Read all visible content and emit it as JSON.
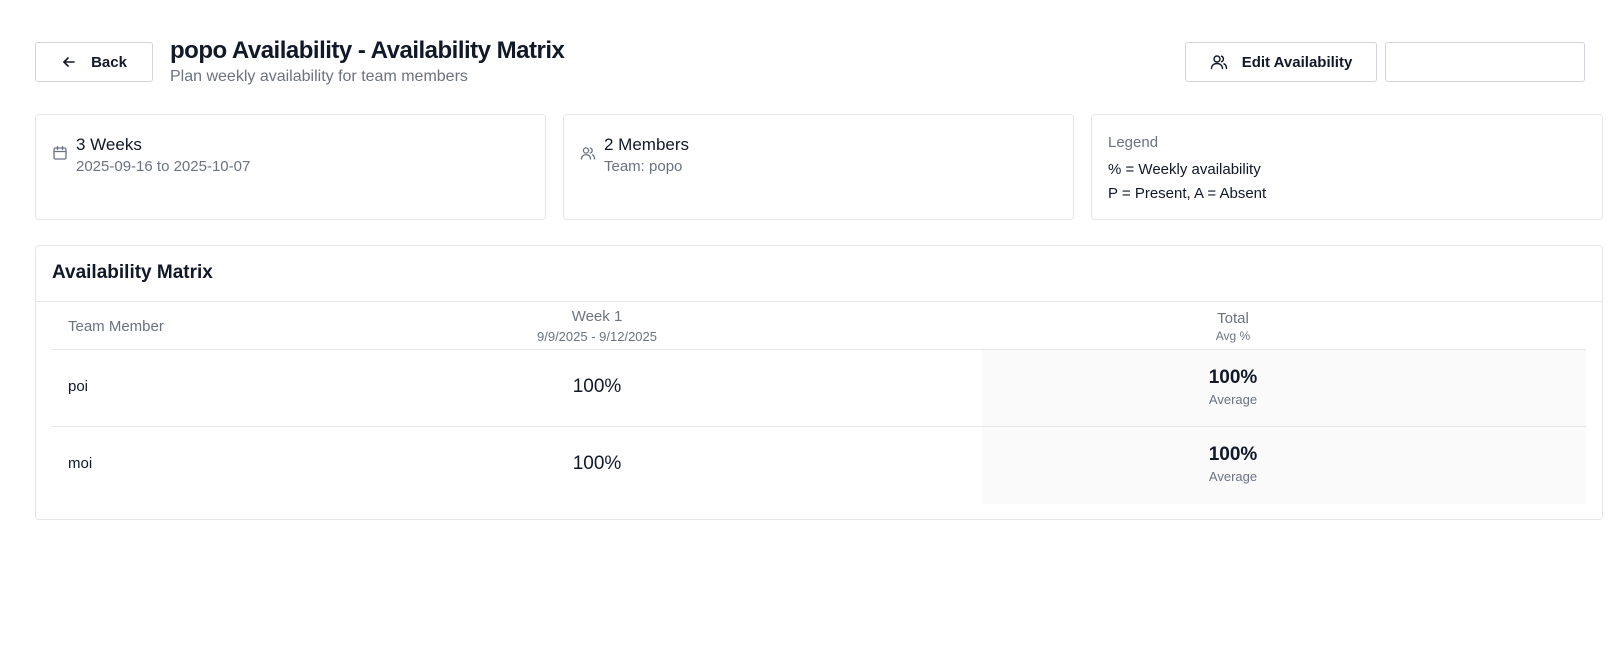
{
  "header": {
    "back_label": "Back",
    "title": "popo Availability - Availability Matrix",
    "subtitle": "Plan weekly availability for team members",
    "edit_label": "Edit Availability"
  },
  "cards": {
    "weeks": {
      "main": "3 Weeks",
      "sub": "2025-09-16 to 2025-10-07",
      "icon": "calendar-icon"
    },
    "members": {
      "main": "2 Members",
      "sub": "Team: popo",
      "icon": "users-icon"
    },
    "legend": {
      "title": "Legend",
      "line1": "% = Weekly availability",
      "line2": "P = Present, A = Absent"
    }
  },
  "matrix": {
    "title": "Availability Matrix",
    "columns": {
      "member": "Team Member",
      "week_label": "Week 1",
      "week_range": "9/9/2025 - 9/12/2025",
      "total_label": "Total",
      "total_sub": "Avg %"
    },
    "rows": [
      {
        "name": "poi",
        "week1": "100%",
        "total": "100%",
        "total_sub": "Average"
      },
      {
        "name": "moi",
        "week1": "100%",
        "total": "100%",
        "total_sub": "Average"
      }
    ]
  }
}
